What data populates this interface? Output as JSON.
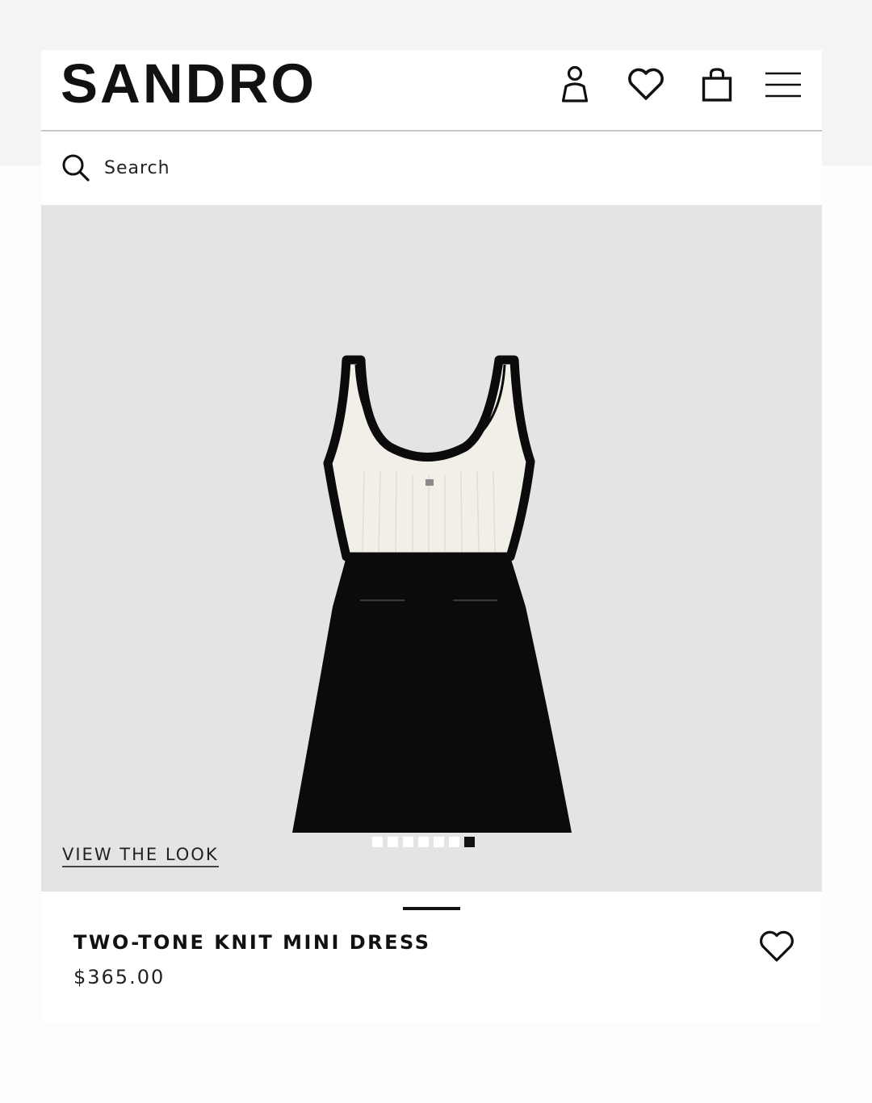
{
  "header": {
    "logo": "SANDRO",
    "icons": [
      "account-icon",
      "heart-icon",
      "shopping-bag-icon",
      "menu-icon"
    ]
  },
  "search": {
    "placeholder": "Search",
    "icon": "search-icon"
  },
  "gallery": {
    "view_look_label": "VIEW THE LOOK",
    "image_count": 7,
    "active_index": 6,
    "background_color": "#e6e4e2"
  },
  "product": {
    "name": "TWO-TONE KNIT MINI DRESS",
    "price": "$365.00",
    "wishlist_icon": "heart-icon"
  },
  "colors": {
    "text": "#111111",
    "divider": "#c9c9c9",
    "dress_top": "#f2efe8",
    "dress_trim": "#111111"
  }
}
